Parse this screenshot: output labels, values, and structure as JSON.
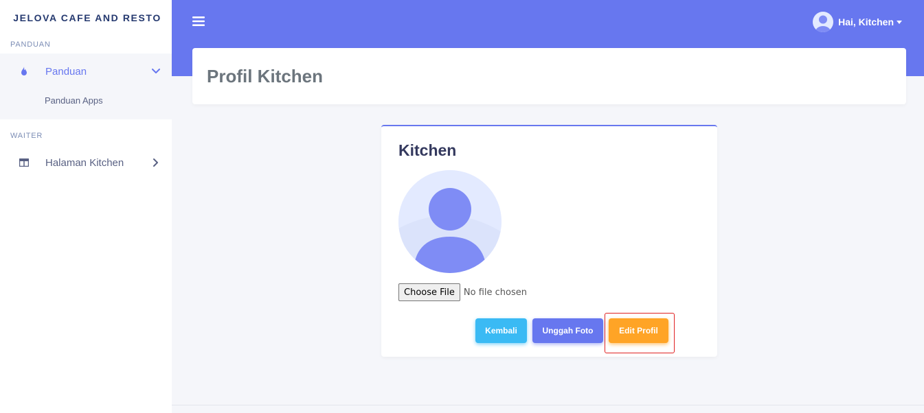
{
  "brand": "JELOVA CAFE AND RESTO",
  "sidebar": {
    "sections": [
      {
        "title": "PANDUAN",
        "items": [
          {
            "label": "Panduan",
            "icon": "fire-icon",
            "active": true,
            "expanded": true,
            "subitems": [
              {
                "label": "Panduan Apps"
              }
            ]
          }
        ]
      },
      {
        "title": "WAITER",
        "items": [
          {
            "label": "Halaman Kitchen",
            "icon": "columns-icon",
            "active": false,
            "expanded": false
          }
        ]
      }
    ]
  },
  "header": {
    "menu_icon": "hamburger-icon",
    "user_greeting": "Hai, Kitchen",
    "user_icon": "avatar-icon"
  },
  "page": {
    "title": "Profil Kitchen"
  },
  "profile": {
    "name": "Kitchen",
    "file_input": {
      "button_label": "Choose File",
      "status": "No file chosen"
    },
    "buttons": {
      "back": "Kembali",
      "upload": "Unggah Foto",
      "edit": "Edit Profil"
    }
  },
  "colors": {
    "primary": "#6777ef",
    "info": "#3abaf4",
    "warning": "#ffa426",
    "highlight": "#e02020",
    "background": "#f5f6fa"
  }
}
